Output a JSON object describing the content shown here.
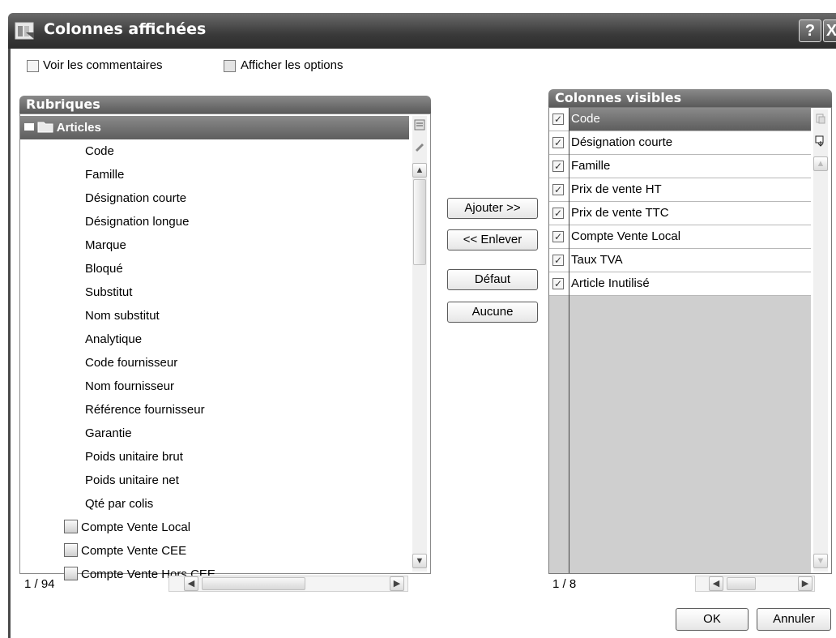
{
  "window": {
    "title": "Colonnes affichées",
    "help_button": "?",
    "close_button": "X"
  },
  "options": {
    "show_comments": "Voir les commentaires",
    "show_options": "Afficher les options"
  },
  "left_panel": {
    "header": "Rubriques",
    "group": "Articles",
    "items": [
      "Code",
      "Famille",
      "Désignation courte",
      "Désignation longue",
      "Marque",
      "Bloqué",
      "Substitut",
      "Nom substitut",
      "Analytique",
      "Code fournisseur",
      "Nom fournisseur",
      "Référence fournisseur",
      "Garantie",
      "Poids unitaire brut",
      "Poids unitaire net",
      "Qté par colis"
    ],
    "sub_items": [
      "Compte Vente Local",
      "Compte Vente CEE",
      "Compte Vente Hors CEE"
    ],
    "status": "1 / 94"
  },
  "buttons": {
    "add": "Ajouter >>",
    "remove": "<< Enlever",
    "default": "Défaut",
    "none": "Aucune",
    "ok": "OK",
    "cancel": "Annuler"
  },
  "right_panel": {
    "header": "Colonnes visibles",
    "items": [
      "Code",
      "Désignation courte",
      "Famille",
      "Prix de vente HT",
      "Prix de vente TTC",
      "Compte Vente Local",
      "Taux TVA",
      "Article Inutilisé"
    ],
    "status": "1 / 8"
  },
  "icons": {
    "app": "dialog-columns-icon",
    "tree_toggle": "collapse-icon",
    "folder": "folder-icon",
    "table_item": "table-field-icon"
  }
}
